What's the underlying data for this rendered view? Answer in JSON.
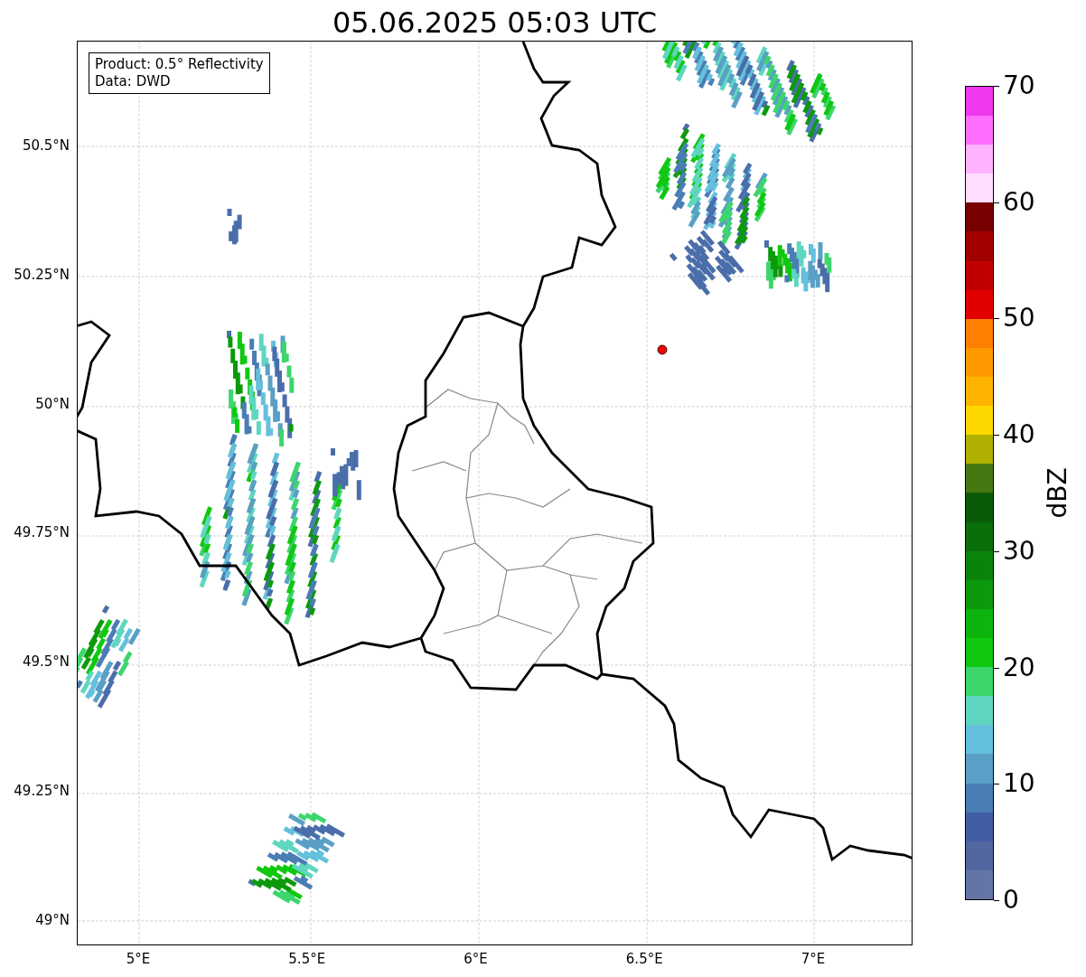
{
  "title": "05.06.2025 05:03 UTC",
  "legend": [
    "Product: 0.5° Reflectivity",
    "Data: DWD"
  ],
  "y_ticks": [
    "50.5°N",
    "50.25°N",
    "50°N",
    "49.75°N",
    "49.5°N",
    "49.25°N",
    "49°N"
  ],
  "x_ticks": [
    "5°E",
    "5.5°E",
    "6°E",
    "6.5°E",
    "7°E"
  ],
  "colorbar": {
    "label": "dBZ",
    "ticks": [
      "70",
      "60",
      "50",
      "40",
      "30",
      "20",
      "10",
      "0"
    ],
    "bins": [
      {
        "color": "#6474a6"
      },
      {
        "color": "#5266a0"
      },
      {
        "color": "#415ea4"
      },
      {
        "color": "#4a7db4"
      },
      {
        "color": "#5a9fc6"
      },
      {
        "color": "#64c0dc"
      },
      {
        "color": "#5fd6c0"
      },
      {
        "color": "#3cd66c"
      },
      {
        "color": "#10c810"
      },
      {
        "color": "#0eb40e"
      },
      {
        "color": "#0c9a0c"
      },
      {
        "color": "#0a830a"
      },
      {
        "color": "#0a6e0a"
      },
      {
        "color": "#0a5a0a"
      },
      {
        "color": "#457810"
      },
      {
        "color": "#b0b000"
      },
      {
        "color": "#ffd700"
      },
      {
        "color": "#ffb300"
      },
      {
        "color": "#ff9900"
      },
      {
        "color": "#ff7f00"
      },
      {
        "color": "#e00000"
      },
      {
        "color": "#c00000"
      },
      {
        "color": "#a00000"
      },
      {
        "color": "#780000"
      },
      {
        "color": "#ffddff"
      },
      {
        "color": "#ffb3ff"
      },
      {
        "color": "#ff6eff"
      },
      {
        "color": "#ee38ee"
      }
    ]
  }
}
